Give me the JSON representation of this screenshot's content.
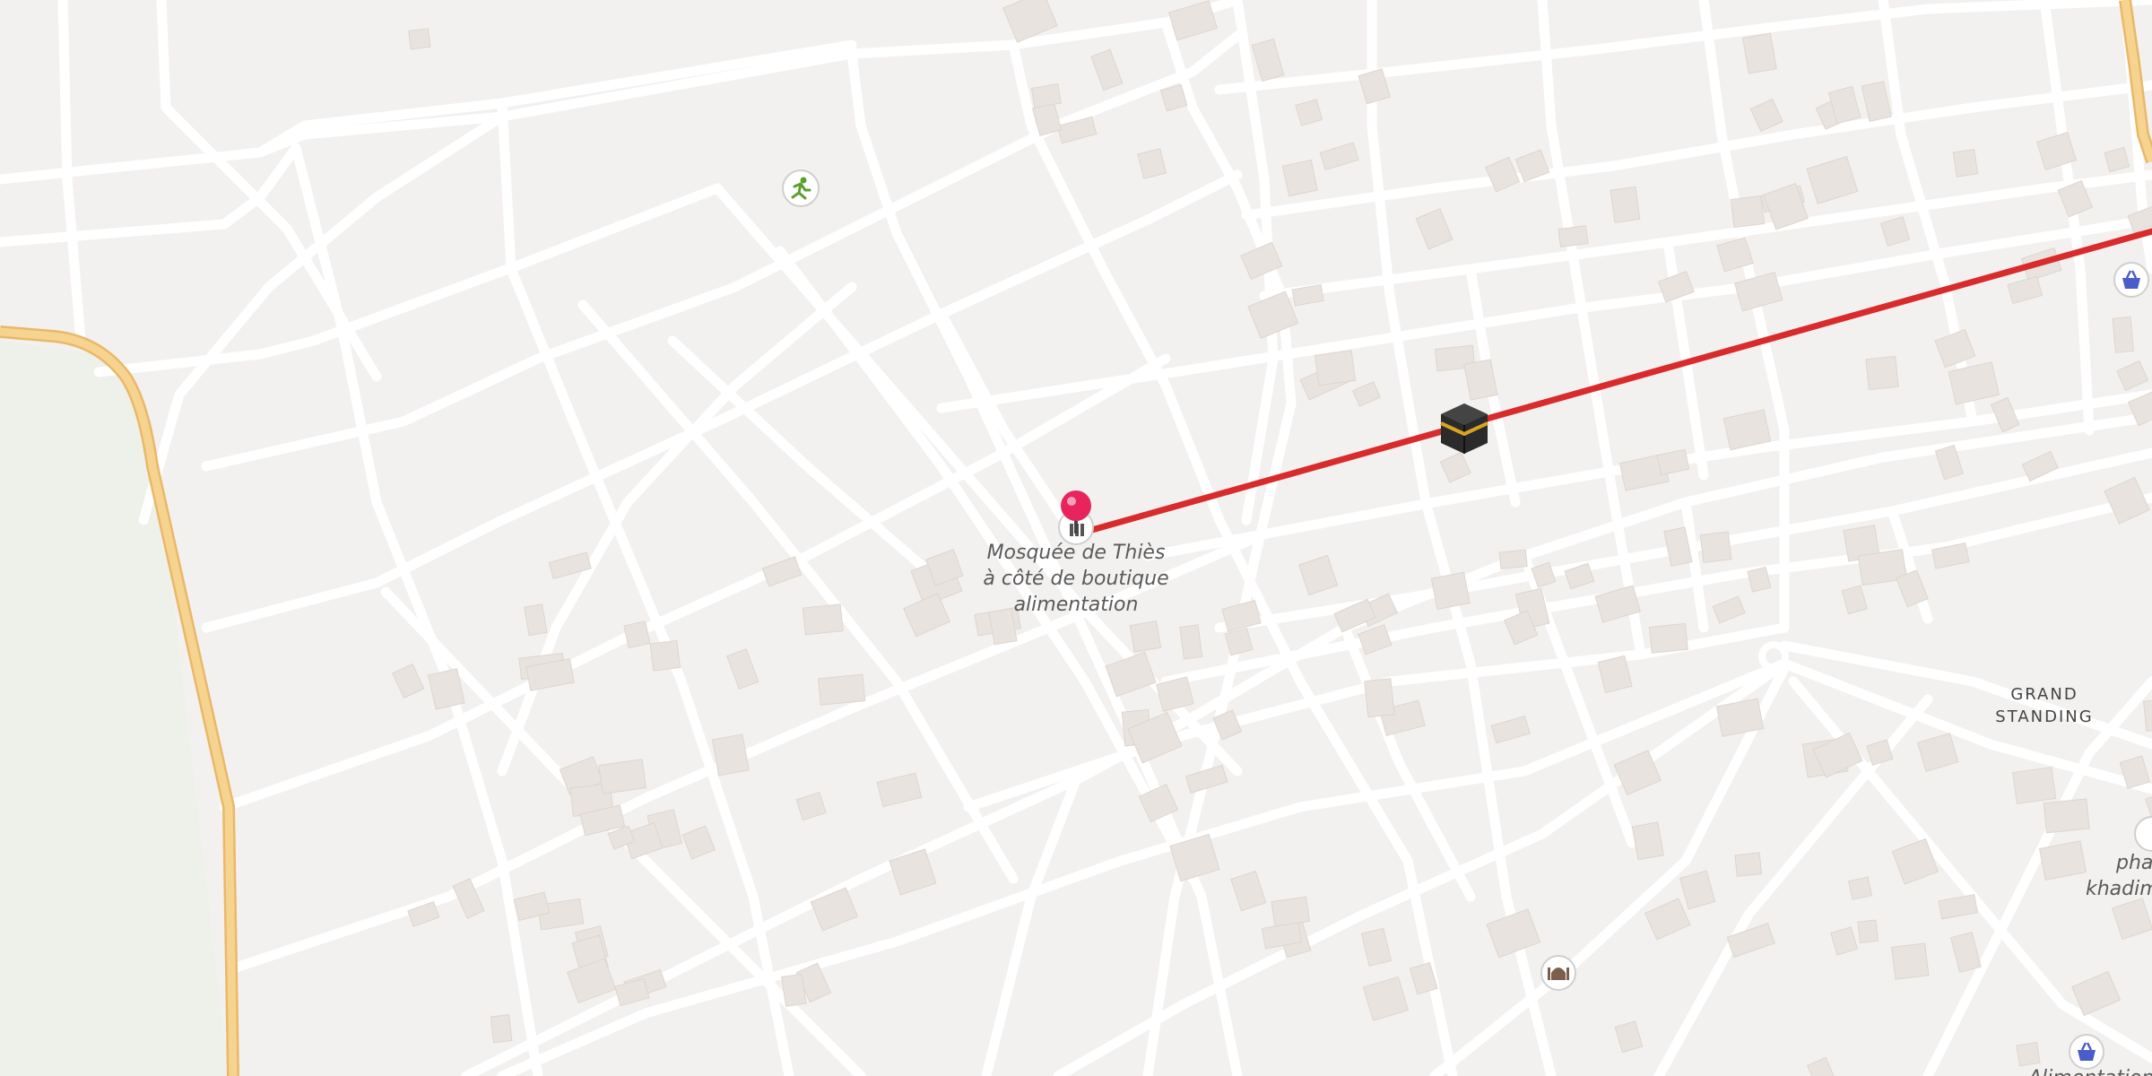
{
  "map": {
    "pin_label": "Mosquée de Thiès\nà côté de boutique\nalimentation",
    "area_label": "GRAND\nSTANDING",
    "edge_label_1": "pha",
    "edge_label_2": "khadim",
    "edge_label_3": "Alimentation",
    "colors": {
      "land": "#f3f1ef",
      "road": "#ffffff",
      "major_road": "#f6d48f",
      "major_road_casing": "#e9b86a",
      "building": "#e8e3de",
      "route": "#d92b2b",
      "pin": "#e8245c",
      "park": "#edf0e8"
    },
    "icons": {
      "pin": "map-pin-icon",
      "destination": "kaaba-icon",
      "mosque": "mosque-icon",
      "sport": "running-person-icon",
      "shop": "shopping-basket-icon"
    }
  }
}
